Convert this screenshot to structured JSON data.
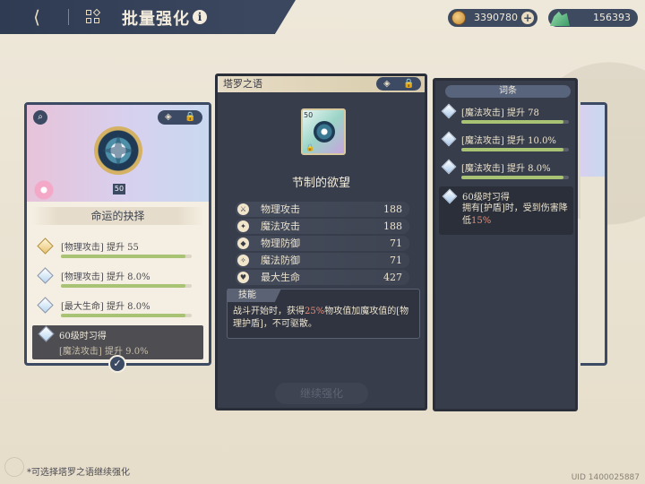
{
  "header": {
    "title": "批量强化",
    "info_glyph": "i",
    "back_glyph": "⟨"
  },
  "currency": {
    "coins": "3390780",
    "gems": "156393",
    "plus_glyph": "+"
  },
  "left_card": {
    "level": "50",
    "name": "命运的抉择",
    "search_glyph": "⌕",
    "lock_glyph": "🔒",
    "settings_glyph": "◈",
    "stats": [
      {
        "text": "[物理攻击] 提升 55",
        "progress": 0.95
      },
      {
        "text": "[物理攻击] 提升 8.0%",
        "progress": 0.95
      },
      {
        "text": "[最大生命] 提升 8.0%",
        "progress": 0.95
      }
    ],
    "unlock_title": "60级时习得",
    "unlock_text": "[魔法攻击] 提升 9.0%",
    "check_glyph": "✓"
  },
  "center_card": {
    "set_name": "塔罗之语",
    "level": "50",
    "name": "节制的欲望",
    "stats": [
      {
        "label": "物理攻击",
        "value": "188",
        "icon": "sword-icon",
        "glyph": "⚔"
      },
      {
        "label": "魔法攻击",
        "value": "188",
        "icon": "wand-icon",
        "glyph": "✦"
      },
      {
        "label": "物理防御",
        "value": "71",
        "icon": "shield-icon",
        "glyph": "◆"
      },
      {
        "label": "魔法防御",
        "value": "71",
        "icon": "magic-shield-icon",
        "glyph": "✧"
      },
      {
        "label": "最大生命",
        "value": "427",
        "icon": "heart-icon",
        "glyph": "♥"
      }
    ],
    "skill_tag": "技能",
    "skill_pre": "战斗开始时，获得",
    "skill_highlight": "25%",
    "skill_post": "物攻值加魔攻值的[物理护盾]，不可驱散。",
    "action_label": "继续强化"
  },
  "affix_panel": {
    "title": "词条",
    "items": [
      {
        "text": "[魔法攻击] 提升 78",
        "progress": 0.95
      },
      {
        "text": "[魔法攻击] 提升 10.0%",
        "progress": 0.95
      },
      {
        "text": "[魔法攻击] 提升 8.0%",
        "progress": 0.95
      }
    ],
    "unlock_title": "60级时习得",
    "unlock_pre": "拥有[护盾]时，受到伤害降低",
    "unlock_highlight": "15%"
  },
  "footer": {
    "note": "*可选择塔罗之语继续强化",
    "uid": "UID 1400025887"
  },
  "colors": {
    "accent_dark": "#3c4a63",
    "highlight": "#e88d78",
    "progress": "#a7c373"
  }
}
